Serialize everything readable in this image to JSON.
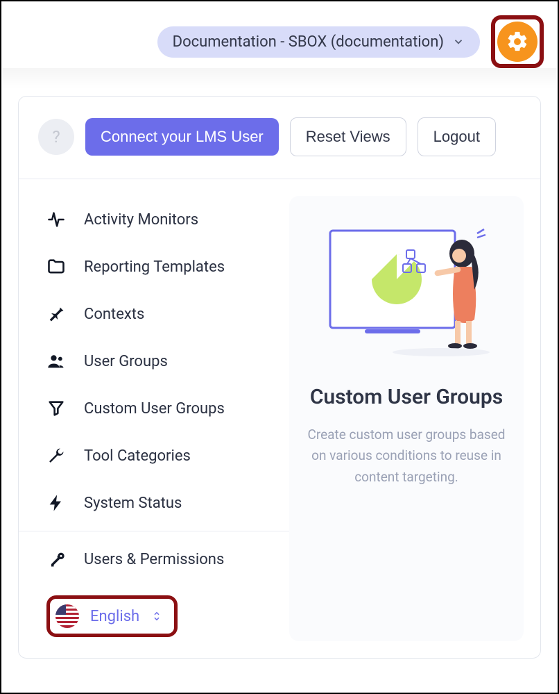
{
  "header": {
    "context_label": "Documentation - SBOX (documentation)"
  },
  "action_bar": {
    "help_label": "?",
    "connect_label": "Connect your LMS User",
    "reset_label": "Reset Views",
    "logout_label": "Logout"
  },
  "sidebar": {
    "items": [
      {
        "label": "Activity Monitors",
        "icon": "activity"
      },
      {
        "label": "Reporting Templates",
        "icon": "folder"
      },
      {
        "label": "Contexts",
        "icon": "pin"
      },
      {
        "label": "User Groups",
        "icon": "users"
      },
      {
        "label": "Custom User Groups",
        "icon": "funnel"
      },
      {
        "label": "Tool Categories",
        "icon": "wrench"
      },
      {
        "label": "System Status",
        "icon": "bolt"
      }
    ],
    "permissions_label": "Users & Permissions"
  },
  "language": {
    "label": "English"
  },
  "feature": {
    "title": "Custom User Groups",
    "description": "Create custom user groups based on various conditions to reuse in content targeting."
  }
}
